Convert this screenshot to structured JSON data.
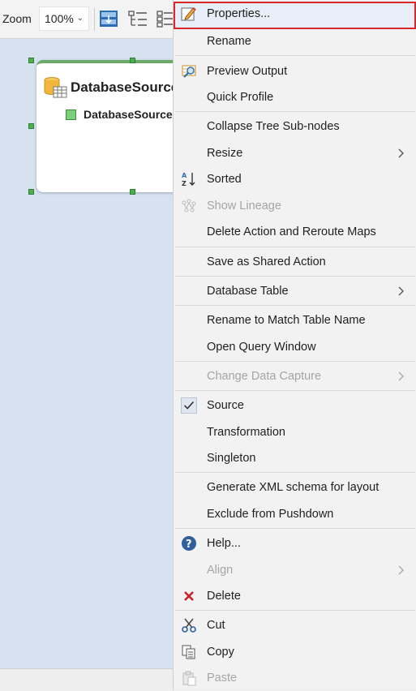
{
  "toolbar": {
    "zoom_label": "Zoom",
    "zoom_value": "100%"
  },
  "node": {
    "title": "DatabaseSource",
    "child": "DatabaseSource"
  },
  "menu": {
    "properties": "Properties...",
    "rename": "Rename",
    "preview_output": "Preview Output",
    "quick_profile": "Quick Profile",
    "collapse_tree": "Collapse Tree Sub-nodes",
    "resize": "Resize",
    "sorted": "Sorted",
    "show_lineage": "Show Lineage",
    "delete_action": "Delete Action and Reroute Maps",
    "save_shared": "Save as Shared Action",
    "database_table": "Database Table",
    "rename_match": "Rename to Match Table Name",
    "open_query": "Open Query Window",
    "change_capture": "Change Data Capture",
    "source": "Source",
    "transformation": "Transformation",
    "singleton": "Singleton",
    "generate_xml": "Generate XML schema for layout",
    "exclude_pushdown": "Exclude from Pushdown",
    "help": "Help...",
    "align": "Align",
    "delete": "Delete",
    "cut": "Cut",
    "copy": "Copy",
    "paste": "Paste"
  },
  "colors": {
    "highlight_border": "#d9272e",
    "node_accent": "#6aa96a",
    "canvas_bg": "#d6e2f0"
  },
  "icons": {
    "properties": "pencil-edit-icon",
    "preview_output": "magnifier-table-icon",
    "sorted": "sort-az-icon",
    "show_lineage": "lineage-icon",
    "source": "checkmark-icon",
    "help": "help-circle-icon",
    "delete": "red-x-icon",
    "cut": "scissors-icon",
    "copy": "copy-icon",
    "paste": "paste-icon"
  }
}
